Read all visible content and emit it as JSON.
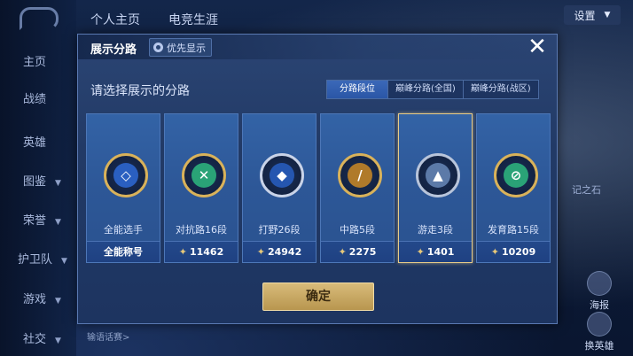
{
  "top_bar": {
    "profile_tab": "个人主页",
    "esports_tab": "电竞生涯",
    "settings": "设置"
  },
  "left_nav": [
    {
      "label": "主页",
      "chevron": false
    },
    {
      "label": "战绩",
      "chevron": false
    },
    {
      "label": "英雄",
      "chevron": false
    },
    {
      "label": "图鉴",
      "chevron": true
    },
    {
      "label": "荣誉",
      "chevron": true
    },
    {
      "label": "护卫队",
      "chevron": true
    },
    {
      "label": "游戏",
      "chevron": true
    },
    {
      "label": "社交",
      "chevron": true
    }
  ],
  "background": {
    "bottom_hint": "输语话赛>",
    "side_text": "记之石",
    "right_btn_1": "海报",
    "right_btn_2": "换英雄"
  },
  "dialog": {
    "title": "展示分路",
    "priority_label": "优先显示",
    "close_symbol": "✕",
    "prompt": "请选择展示的分路",
    "tabs": [
      "分路段位",
      "巅峰分路(全国)",
      "巅峰分路(战区)"
    ],
    "active_tab": 0,
    "confirm": "确定",
    "cards": [
      {
        "label": "全能选手",
        "bottom": "全能称号",
        "has_star": false,
        "selected": false,
        "glyph": "◇",
        "ring": "#d9b25a",
        "fill": "#2a5fc0"
      },
      {
        "label": "对抗路16段",
        "bottom": "11462",
        "has_star": true,
        "selected": false,
        "glyph": "✕",
        "ring": "#d9b25a",
        "fill": "#2aa377"
      },
      {
        "label": "打野26段",
        "bottom": "24942",
        "has_star": true,
        "selected": false,
        "glyph": "◆",
        "ring": "#c9d3e8",
        "fill": "#2556b0"
      },
      {
        "label": "中路5段",
        "bottom": "2275",
        "has_star": true,
        "selected": false,
        "glyph": "/",
        "ring": "#d9b25a",
        "fill": "#b07a2a"
      },
      {
        "label": "游走3段",
        "bottom": "1401",
        "has_star": true,
        "selected": true,
        "glyph": "▲",
        "ring": "#b8c4da",
        "fill": "#5c7aa8"
      },
      {
        "label": "发育路15段",
        "bottom": "10209",
        "has_star": true,
        "selected": false,
        "glyph": "⊘",
        "ring": "#d9b25a",
        "fill": "#2aa377"
      }
    ]
  }
}
